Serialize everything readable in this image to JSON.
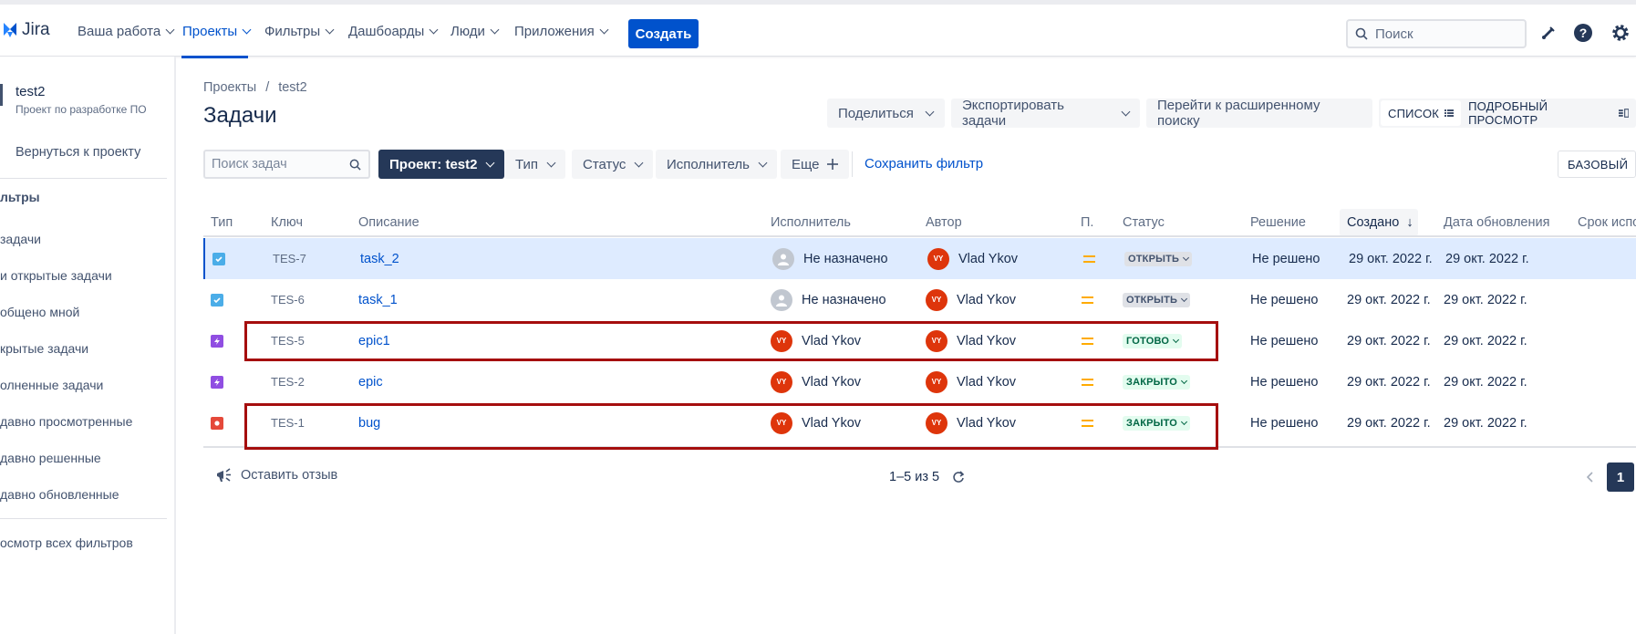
{
  "topnav": {
    "logo_text": "Jira",
    "items": [
      {
        "label": "Ваша работа",
        "active": false
      },
      {
        "label": "Проекты",
        "active": true
      },
      {
        "label": "Фильтры",
        "active": false
      },
      {
        "label": "Дашбоарды",
        "active": false
      },
      {
        "label": "Люди",
        "active": false
      },
      {
        "label": "Приложения",
        "active": false
      }
    ],
    "create_label": "Создать",
    "search_placeholder": "Поиск",
    "icons": [
      "notifications-icon",
      "help-icon",
      "settings-icon"
    ]
  },
  "sidebar": {
    "project_name": "test2",
    "project_subtitle": "Проект по разработке ПО",
    "back_link": "Вернуться к проекту",
    "heading": "льтры",
    "items": [
      "задачи",
      "и открытые задачи",
      "общено мной",
      "крытые задачи",
      "олненные задачи",
      "давно просмотренные",
      "давно решенные",
      "давно обновленные"
    ],
    "footer_link": "осмотр всех фильтров"
  },
  "main": {
    "breadcrumb": [
      "Проекты",
      "/",
      "test2"
    ],
    "title": "Задачи",
    "share_label": "Поделиться",
    "export_label": "Экспортировать задачи",
    "advanced_label": "Перейти к расширенному поиску",
    "view_list": "СПИСОК",
    "view_detail": "ПОДРОБНЫЙ ПРОСМОТР"
  },
  "filters": {
    "search_placeholder": "Поиск задач",
    "project": "Проект: test2",
    "type": "Тип",
    "status": "Статус",
    "assignee": "Исполнитель",
    "more": "Еще",
    "save": "Сохранить фильтр",
    "basic": "БАЗОВЫЙ"
  },
  "table": {
    "headers": {
      "type": "Тип",
      "key": "Ключ",
      "summary": "Описание",
      "assignee": "Исполнитель",
      "reporter": "Автор",
      "priority": "П.",
      "status": "Статус",
      "resolution": "Решение",
      "created": "Создано",
      "updated": "Дата обновления",
      "due": "Срок испо"
    },
    "rows": [
      {
        "type": "task",
        "key": "TES-7",
        "summary": "task_2",
        "assignee": "Не назначено",
        "assignee_initials": "",
        "reporter": "Vlad Ykov",
        "reporter_initials": "VY",
        "status": "ОТКРЫТЬ",
        "status_color": "grey",
        "resolution": "Не решено",
        "created": "29 окт. 2022 г.",
        "updated": "29 окт. 2022 г."
      },
      {
        "type": "task",
        "key": "TES-6",
        "summary": "task_1",
        "assignee": "Не назначено",
        "assignee_initials": "",
        "reporter": "Vlad Ykov",
        "reporter_initials": "VY",
        "status": "ОТКРЫТЬ",
        "status_color": "grey",
        "resolution": "Не решено",
        "created": "29 окт. 2022 г.",
        "updated": "29 окт. 2022 г."
      },
      {
        "type": "epic",
        "key": "TES-5",
        "summary": "epic1",
        "assignee": "Vlad Ykov",
        "assignee_initials": "VY",
        "reporter": "Vlad Ykov",
        "reporter_initials": "VY",
        "status": "ГОТОВО",
        "status_color": "green",
        "resolution": "Не решено",
        "created": "29 окт. 2022 г.",
        "updated": "29 окт. 2022 г."
      },
      {
        "type": "epic",
        "key": "TES-2",
        "summary": "epic",
        "assignee": "Vlad Ykov",
        "assignee_initials": "VY",
        "reporter": "Vlad Ykov",
        "reporter_initials": "VY",
        "status": "ЗАКРЫТО",
        "status_color": "green",
        "resolution": "Не решено",
        "created": "29 окт. 2022 г.",
        "updated": "29 окт. 2022 г."
      },
      {
        "type": "bug",
        "key": "TES-1",
        "summary": "bug",
        "assignee": "Vlad Ykov",
        "assignee_initials": "VY",
        "reporter": "Vlad Ykov",
        "reporter_initials": "VY",
        "status": "ЗАКРЫТО",
        "status_color": "green",
        "resolution": "Не решено",
        "created": "29 окт. 2022 г.",
        "updated": "29 окт. 2022 г."
      }
    ]
  },
  "footer": {
    "feedback": "Оставить отзыв",
    "count": "1–5 из 5",
    "page": "1"
  },
  "colors": {
    "accent": "#0052cc",
    "selected_row": "#deebff",
    "highlight": "#a50e0e",
    "task_icon": "#4bade8",
    "epic_icon": "#904ee2",
    "bug_icon": "#e5493a"
  }
}
